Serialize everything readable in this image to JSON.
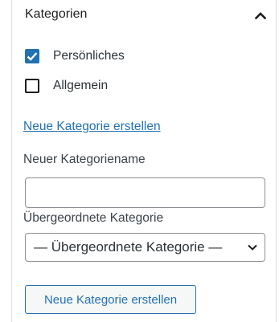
{
  "panel": {
    "title": "Kategorien",
    "toggle_icon": "chevron-up-icon",
    "expanded": true
  },
  "categories": [
    {
      "label": "Persönliches",
      "checked": true
    },
    {
      "label": "Allgemein",
      "checked": false
    }
  ],
  "new_category_link": "Neue Kategorie erstellen",
  "form": {
    "name_label": "Neuer Kategoriename",
    "name_value": "",
    "name_placeholder": "",
    "parent_label": "Übergeordnete Kategorie",
    "parent_selected": "— Übergeordnete Kategorie —",
    "submit_label": "Neue Kategorie erstellen"
  },
  "colors": {
    "accent": "#2271b1",
    "text": "#1e1e1e",
    "border": "#8c8f94"
  }
}
